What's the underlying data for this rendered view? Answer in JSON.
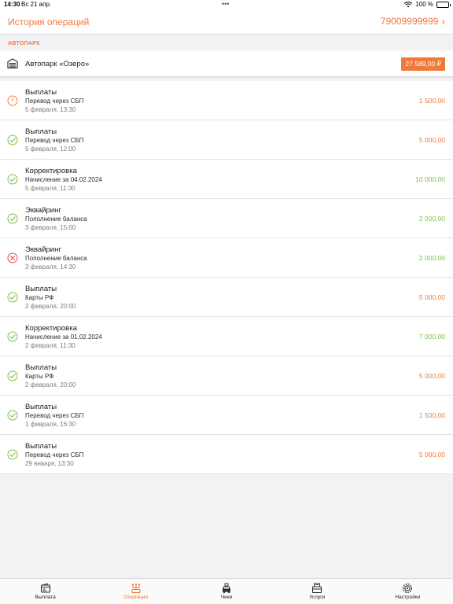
{
  "status_bar": {
    "time": "14:30",
    "date": "Вс 21 апр.",
    "dots": "•••",
    "battery": "100 %"
  },
  "nav": {
    "title": "История операций",
    "phone": "79009999999",
    "chevron": "›"
  },
  "section": {
    "label": "АВТОПАРК"
  },
  "fleet": {
    "icon": "garage-icon",
    "name": "Автопарк «Озеро»",
    "balance": "27 589,00 ₽"
  },
  "colors": {
    "accent": "#f07a3c",
    "income": "#79c14a",
    "error": "#e5533d"
  },
  "operations": [
    {
      "status": "pending",
      "title": "Выплаты",
      "subtitle": "Перевод через СБП",
      "date": "5 февраля, 13:30",
      "amount": "1 500,00",
      "direction": "out"
    },
    {
      "status": "success",
      "title": "Выплаты",
      "subtitle": "Перевод через СБП",
      "date": "5 февраля, 12:00",
      "amount": "5 000,00",
      "direction": "out"
    },
    {
      "status": "success",
      "title": "Корректировка",
      "subtitle": "Начисление за 04.02.2024",
      "date": "5 февраля, 11:30",
      "amount": "10 000,00",
      "direction": "in"
    },
    {
      "status": "success",
      "title": "Эквайринг",
      "subtitle": "Пополнение баланса",
      "date": "3 февраля, 15:00",
      "amount": "2 000,00",
      "direction": "in"
    },
    {
      "status": "failed",
      "title": "Эквайринг",
      "subtitle": "Пополнение баланса",
      "date": "3 февраля, 14:30",
      "amount": "2 000,00",
      "direction": "in"
    },
    {
      "status": "success",
      "title": "Выплаты",
      "subtitle": "Карты РФ",
      "date": "2 февраля, 20:00",
      "amount": "5 000,00",
      "direction": "out"
    },
    {
      "status": "success",
      "title": "Корректировка",
      "subtitle": "Начисление за 01.02.2024",
      "date": "2 февраля, 11:30",
      "amount": "7 000,00",
      "direction": "in"
    },
    {
      "status": "success",
      "title": "Выплаты",
      "subtitle": "Карты РФ",
      "date": "2 февраля, 20:00",
      "amount": "5 000,00",
      "direction": "out"
    },
    {
      "status": "success",
      "title": "Выплаты",
      "subtitle": "Перевод через СБП",
      "date": "1 февраля, 16:30",
      "amount": "1 500,00",
      "direction": "out"
    },
    {
      "status": "success",
      "title": "Выплаты",
      "subtitle": "Перевод через СБП",
      "date": "29 января, 13:30",
      "amount": "5 000,00",
      "direction": "out"
    }
  ],
  "tabs": [
    {
      "label": "Выплата",
      "icon": "wallet-icon",
      "active": false
    },
    {
      "label": "Операции",
      "icon": "operations-icon",
      "active": true
    },
    {
      "label": "Чеки",
      "icon": "car-receipt-icon",
      "active": false
    },
    {
      "label": "Услуги",
      "icon": "services-icon",
      "active": false
    },
    {
      "label": "Настройки",
      "icon": "settings-gear-icon",
      "active": false
    }
  ]
}
